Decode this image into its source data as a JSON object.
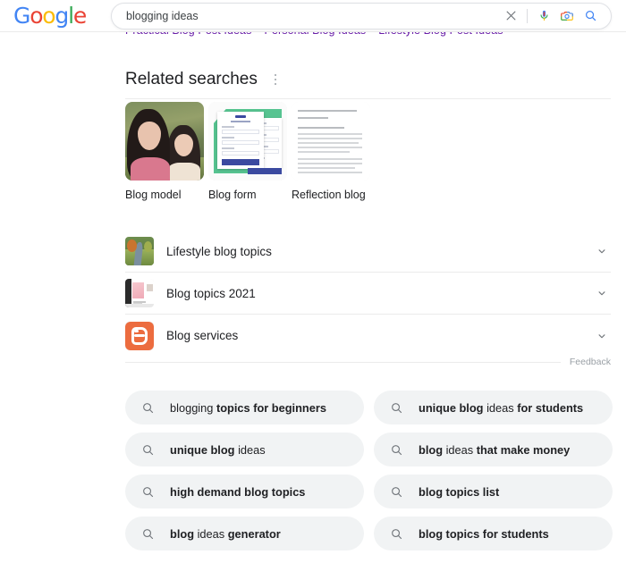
{
  "header": {
    "logo": "Google",
    "logo_letters": [
      {
        "char": "G",
        "color": "#4285f4"
      },
      {
        "char": "o",
        "color": "#ea4335"
      },
      {
        "char": "o",
        "color": "#fbbc05"
      },
      {
        "char": "g",
        "color": "#4285f4"
      },
      {
        "char": "l",
        "color": "#34a853"
      },
      {
        "char": "e",
        "color": "#ea4335"
      }
    ],
    "search_query": "blogging ideas",
    "search_placeholder": "Search",
    "clear_label": "Clear",
    "voice_label": "Search by voice",
    "lens_label": "Search by image",
    "search_label": "Google Search"
  },
  "cut_off_links": [
    "Practical Blog Post Ideas",
    "Personal Blog Ideas",
    "Lifestyle Blog Post Ideas"
  ],
  "related_searches": {
    "title": "Related searches",
    "menu_label": "About this result",
    "tiles": [
      {
        "label": "Blog model",
        "thumb": "selfie-photo"
      },
      {
        "label": "Blog form",
        "thumb": "form-mockup"
      },
      {
        "label": "Reflection blog",
        "thumb": "document-page"
      }
    ],
    "rows": [
      {
        "label": "Lifestyle blog topics",
        "thumb": "landscape-photo"
      },
      {
        "label": "Blog topics 2021",
        "thumb": "website-screenshot"
      },
      {
        "label": "Blog services",
        "thumb": "blogger-logo"
      }
    ],
    "feedback": "Feedback"
  },
  "chips": [
    {
      "parts": [
        {
          "t": "blogging ",
          "b": false
        },
        {
          "t": "topics for beginners",
          "b": true
        }
      ]
    },
    {
      "parts": [
        {
          "t": "unique blog ",
          "b": true
        },
        {
          "t": "ideas ",
          "b": false
        },
        {
          "t": "for students",
          "b": true
        }
      ]
    },
    {
      "parts": [
        {
          "t": "unique blog ",
          "b": true
        },
        {
          "t": "ideas",
          "b": false
        }
      ]
    },
    {
      "parts": [
        {
          "t": "blog ",
          "b": true
        },
        {
          "t": "ideas ",
          "b": false
        },
        {
          "t": "that make money",
          "b": true
        }
      ]
    },
    {
      "parts": [
        {
          "t": "high demand blog topics",
          "b": true
        }
      ]
    },
    {
      "parts": [
        {
          "t": "blog topics list",
          "b": true
        }
      ]
    },
    {
      "parts": [
        {
          "t": "blog ",
          "b": true
        },
        {
          "t": "ideas ",
          "b": false
        },
        {
          "t": "generator",
          "b": true
        }
      ]
    },
    {
      "parts": [
        {
          "t": "blog topics for students",
          "b": true
        }
      ]
    }
  ],
  "colors": {
    "chip_bg": "#f1f3f4",
    "link_visited": "#681da8",
    "text_primary": "#202124",
    "text_muted": "#9aa0a6",
    "blogger_orange": "#ec6c3f",
    "form_green": "#57c491"
  }
}
